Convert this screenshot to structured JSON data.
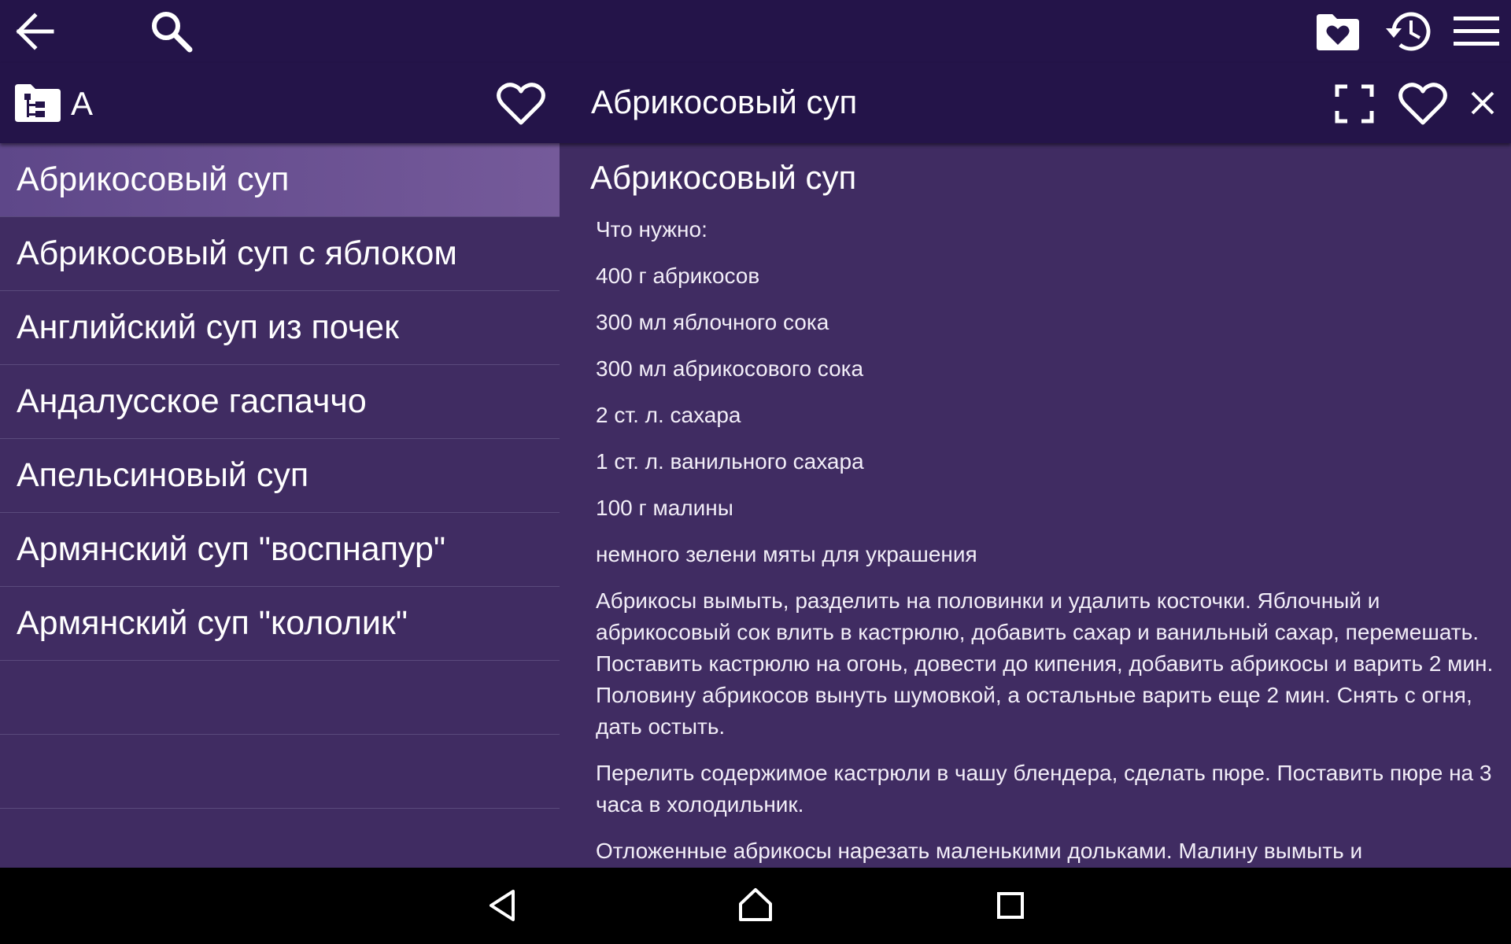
{
  "topbar": {
    "back_icon": "arrow-left-icon",
    "search_icon": "search-icon",
    "favorites_folder_icon": "folder-heart-icon",
    "history_icon": "history-icon",
    "menu_icon": "hamburger-menu-icon"
  },
  "subbar": {
    "category_icon": "folder-tree-icon",
    "category_letter": "А",
    "list_favorite_icon": "heart-outline-icon",
    "article_title": "Абрикосовый суп",
    "fullscreen_icon": "fullscreen-icon",
    "article_favorite_icon": "heart-outline-icon",
    "close_icon": "close-icon"
  },
  "list": {
    "items": [
      {
        "label": "Абрикосовый суп",
        "selected": true
      },
      {
        "label": "Абрикосовый суп с яблоком",
        "selected": false
      },
      {
        "label": "Английский суп из почек",
        "selected": false
      },
      {
        "label": "Андалусское гаспаччо",
        "selected": false
      },
      {
        "label": "Апельсиновый суп",
        "selected": false
      },
      {
        "label": "Армянский суп \"воспнапур\"",
        "selected": false
      },
      {
        "label": "Армянский суп \"кололик\"",
        "selected": false
      }
    ]
  },
  "article": {
    "heading": "Абрикосовый суп",
    "paragraphs": [
      "Что нужно:",
      "400 г абрикосов",
      "300 мл яблочного сока",
      "300 мл абрикосового сока",
      "2 ст. л. сахара",
      "1 ст. л. ванильного сахара",
      "100 г малины",
      "немного зелени мяты для украшения",
      "Абрикосы вымыть, разделить на половинки и удалить косточки. Яблочный и абрикосовый сок влить в кастрюлю, добавить сахар и ванильный сахар, перемешать. Поставить кастрюлю на огонь, довести до кипения, добавить абрикосы и варить 2 мин. Половину абрикосов вынуть шумовкой, а остальные варить еще 2 мин. Снять с огня, дать остыть.",
      "Перелить содержимое кастрюли в чашу блендера, сделать пюре. Поставить пюре на 3 часа в холодильник.",
      "Отложенные абрикосы нарезать маленькими дольками. Малину вымыть и"
    ]
  },
  "navbar": {
    "back_icon": "nav-back-triangle-icon",
    "home_icon": "nav-home-icon",
    "recents_icon": "nav-recents-square-icon"
  },
  "colors": {
    "bar_bg": "#241449",
    "pane_bg": "#402c62",
    "selected_bg": "#6a5294",
    "divider": "#5a4a7c"
  }
}
